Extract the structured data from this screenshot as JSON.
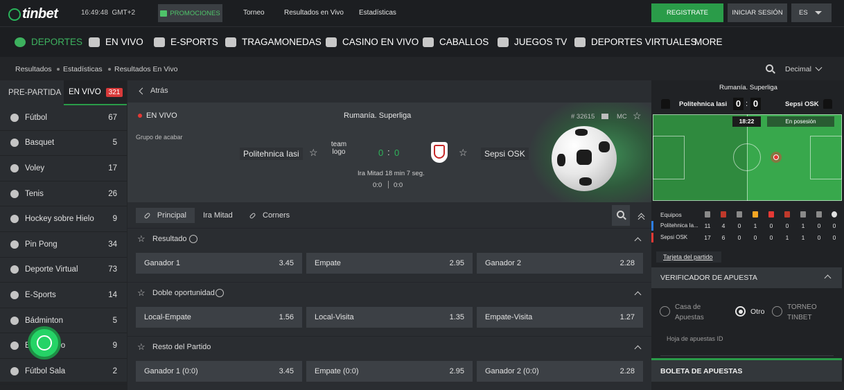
{
  "brand": {
    "name": "tinbet"
  },
  "header": {
    "clock": "16:49:48",
    "timezone": "GMT+2",
    "promo_label": "PROMOCIONES",
    "links": [
      "Torneo",
      "Resultados en Vivo",
      "Estadísticas"
    ],
    "register_label": "REGISTRATE",
    "login_label": "INICIAR SESIÓN",
    "language": "ES"
  },
  "categories": [
    "DEPORTES",
    "EN VIVO",
    "E-SPORTS",
    "TRAGAMONEDAS",
    "CASINO EN VIVO",
    "CABALLOS",
    "JUEGOS TV",
    "DEPORTES VIRTUALES",
    "MORE"
  ],
  "breadcrumb": [
    "Resultados",
    "Estadísticas",
    "Resultados En Vivo"
  ],
  "odds_format": "Decimal",
  "sidebar": {
    "tab_prematch": "PRE-PARTIDA",
    "tab_live": "EN VIVO",
    "live_count": "321",
    "sports": [
      {
        "label": "Fútbol",
        "count": "67"
      },
      {
        "label": "Basquet",
        "count": "5"
      },
      {
        "label": "Voley",
        "count": "17"
      },
      {
        "label": "Tenis",
        "count": "26"
      },
      {
        "label": "Hockey sobre Hielo",
        "count": "9"
      },
      {
        "label": "Pin Pong",
        "count": "34"
      },
      {
        "label": "Deporte Virtual",
        "count": "73"
      },
      {
        "label": "E-Sports",
        "count": "14"
      },
      {
        "label": "Bádminton",
        "count": "5"
      },
      {
        "label": "Balonmano",
        "count": "9"
      },
      {
        "label": "Fútbol Sala",
        "count": "2"
      }
    ]
  },
  "match": {
    "back_label": "Atrás",
    "live_label": "EN VIVO",
    "league": "Rumanía. Superliga",
    "group": "Grupo de acabar",
    "match_id": "# 32615",
    "mc_label": "MC",
    "home": "Politehnica Iasi",
    "away": "Sepsi OSK",
    "home_logo_alt": "team logo",
    "score_home": "0",
    "score_away": "0",
    "period": "Ira Mitad 18 min 7 seg.",
    "half1": "0:0",
    "half2": "0:0"
  },
  "subtabs": [
    "Principal",
    "Ira Mitad",
    "Corners"
  ],
  "markets": [
    {
      "title": "Resultado",
      "outcomes": [
        {
          "label": "Ganador 1",
          "odd": "3.45"
        },
        {
          "label": "Empate",
          "odd": "2.95"
        },
        {
          "label": "Ganador 2",
          "odd": "2.28"
        }
      ]
    },
    {
      "title": "Doble oportunidad",
      "outcomes": [
        {
          "label": "Local-Empate",
          "odd": "1.56"
        },
        {
          "label": "Local-Visita",
          "odd": "1.35"
        },
        {
          "label": "Empate-Visita",
          "odd": "1.27"
        }
      ]
    },
    {
      "title": "Resto del Partido",
      "outcomes": [
        {
          "label": "Ganador 1 (0:0)",
          "odd": "3.45"
        },
        {
          "label": "Empate (0:0)",
          "odd": "2.95"
        },
        {
          "label": "Ganador 2 (0:0)",
          "odd": "2.28"
        }
      ]
    }
  ],
  "tracker": {
    "league": "Rumanía. Superliga",
    "home": "Politehnica Iasi",
    "away": "Sepsi OSK",
    "score_home": "0",
    "score_away": "0",
    "time": "18:22",
    "possession": "En posesión",
    "stats_header": "Equipos",
    "rows": [
      {
        "team": "Politehnica Ia...",
        "values": [
          "11",
          "4",
          "0",
          "1",
          "0",
          "0",
          "1",
          "0",
          "0"
        ]
      },
      {
        "team": "Sepsi OSK",
        "values": [
          "17",
          "6",
          "0",
          "0",
          "0",
          "1",
          "1",
          "0",
          "0"
        ]
      }
    ],
    "card_link": "Tarjeta del partido"
  },
  "bet_checker": {
    "title": "VERIFICADOR DE APUESTA",
    "options": [
      "Casa de Apuestas",
      "Otro",
      "TORNEO TINBET"
    ],
    "id_placeholder": "Hoja de apuestas ID"
  },
  "betslip": {
    "title": "BOLETA DE APUESTAS"
  },
  "colors": {
    "accent": "#2a9c49",
    "live_red": "#e53935"
  }
}
